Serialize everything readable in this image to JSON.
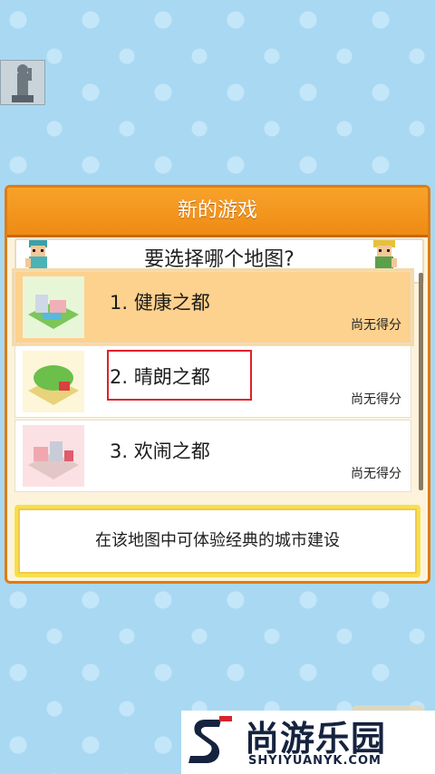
{
  "dialog": {
    "title": "新的游戏",
    "question": "要选择哪个地图?",
    "maps": [
      {
        "label": "1. 健康之都",
        "score": "尚无得分",
        "selected": true
      },
      {
        "label": "2. 晴朗之都",
        "score": "尚无得分",
        "selected": false
      },
      {
        "label": "3. 欢闹之都",
        "score": "尚无得分",
        "selected": false
      }
    ],
    "description": "在该地图中可体验经典的城市建设"
  },
  "watermark": {
    "cn": "尚游乐园",
    "en": "SHYIYUANYK.COM"
  },
  "colors": {
    "background": "#a9d8f3",
    "header_orange": "#ee8b14",
    "selected_row": "#fdd18e",
    "highlight_red": "#e0202b",
    "desc_border": "#f7e04a"
  }
}
